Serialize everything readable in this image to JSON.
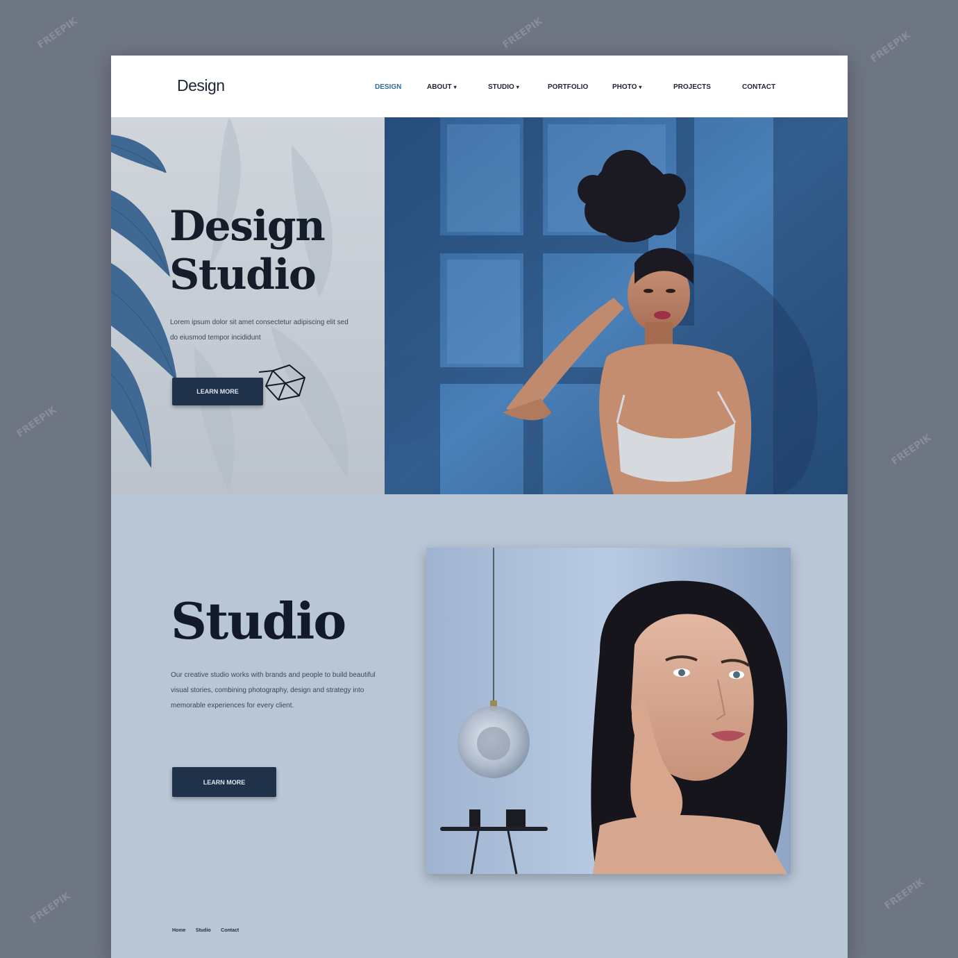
{
  "header": {
    "logo": "Design",
    "nav": [
      {
        "label": "DESIGN",
        "has_dropdown": false,
        "active": true
      },
      {
        "label": "ABOUT",
        "has_dropdown": true,
        "active": false
      },
      {
        "label": "STUDIO",
        "has_dropdown": true,
        "active": false
      },
      {
        "label": "PORTFOLIO",
        "has_dropdown": false,
        "active": false
      },
      {
        "label": "PHOTO",
        "has_dropdown": true,
        "active": false
      },
      {
        "label": "PROJECTS",
        "has_dropdown": false,
        "active": false
      },
      {
        "label": "CONTACT",
        "has_dropdown": false,
        "active": false
      }
    ],
    "dropdown_icon": "chevron-down-icon"
  },
  "hero": {
    "title_line1": "Design",
    "title_line2": "Studio",
    "description": "Lorem ipsum dolor sit amet consectetur adipiscing elit sed do eiusmod tempor incididunt",
    "cta_label": "LEARN MORE",
    "photo_subject": "Woman with curly hair posing against a blue wall",
    "decor_icons": [
      "leaf-icon",
      "gem-icon"
    ]
  },
  "studio": {
    "title": "Studio",
    "description": "Our creative studio works with brands and people to build beautiful visual stories, combining photography, design and strategy into memorable experiences for every client.",
    "cta_label": "LEARN MORE",
    "photo_subject": "Woman with long dark hair beside a glass pendant lamp"
  },
  "footer": {
    "links": [
      "Home",
      "Studio",
      "Contact"
    ]
  },
  "watermark": "FREEPIK",
  "colors": {
    "accent": "#2f6c96",
    "button": "#1f3249",
    "hero_blue": "#3e6fa4",
    "section_bg": "#b9c6d5"
  }
}
